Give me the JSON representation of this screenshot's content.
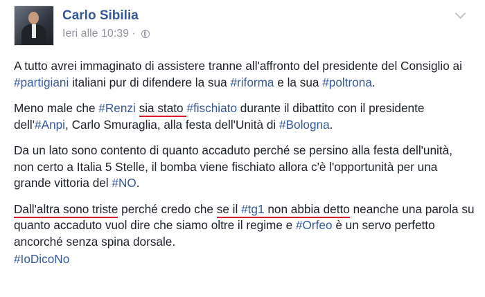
{
  "author": {
    "name": "Carlo Sibilia",
    "time": "Ieri alle 10:39"
  },
  "p1": {
    "t1": "A tutto avrei immaginato di assistere tranne all'affronto del presidente del Consiglio ai ",
    "h1": "#partigiani",
    "t2": " italiani pur di difendere la sua ",
    "h2": "#riforma",
    "t3": " e la sua ",
    "h3": "#poltrona",
    "t4": "."
  },
  "p2": {
    "t1": "Meno male che ",
    "h1": "#Renzi",
    "t2": " ",
    "u1": "sia stato",
    "t3": " ",
    "h2": "#fischiato",
    "t4": " durante il dibattito con il presidente dell'",
    "h3": "#Anpi",
    "t5": ", Carlo Smuraglia, alla festa dell'Unità di ",
    "h4": "#Bologna",
    "t6": "."
  },
  "p3": {
    "t1": "Da un lato sono contento di quanto accaduto perché se persino alla festa dell'unità, non certo a Italia 5 Stelle, il bomba viene fischiato allora c'è l'opportunità per una grande vittoria del ",
    "h1": "#NO",
    "t2": "."
  },
  "p4": {
    "u1": "Dall'altra sono triste",
    "t1": " perché credo che ",
    "u2a": "se il ",
    "u2h": "#tg1",
    "u2b": " non abbia detto",
    "t2": " neanche una parola su quanto accaduto vuol dire che siamo oltre il regime e ",
    "h1": "#Orfeo",
    "t3": " è un servo perfetto ancorché senza spina dorsale."
  },
  "footer_tag": "#IoDicoNo",
  "colors": {
    "link": "#365899",
    "underline": "#d9192b",
    "text": "#1d2129",
    "meta": "#90949c"
  },
  "icons": [
    "globe-icon",
    "chevron-down-icon"
  ]
}
